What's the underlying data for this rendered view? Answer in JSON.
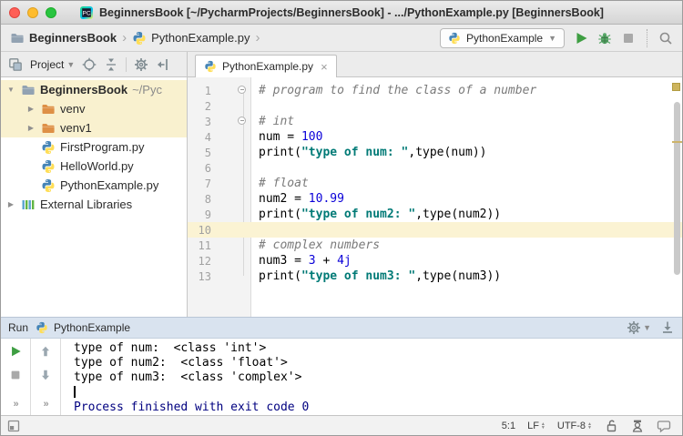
{
  "window": {
    "title": "BeginnersBook [~/PycharmProjects/BeginnersBook] - .../PythonExample.py [BeginnersBook]"
  },
  "toolbar": {
    "breadcrumbs": [
      {
        "label": "BeginnersBook",
        "icon": "folder-gray",
        "bold": true
      },
      {
        "label": "PythonExample.py",
        "icon": "python",
        "bold": false
      }
    ],
    "run_config": "PythonExample"
  },
  "project_panel": {
    "title": "Project",
    "tree": [
      {
        "label": "BeginnersBook",
        "suffix": "~/Pyc",
        "icon": "folder-gray",
        "arrow": "expanded",
        "indent": 0,
        "bold": true,
        "highlight": true
      },
      {
        "label": "venv",
        "icon": "folder-orange",
        "arrow": "collapsed",
        "indent": 1,
        "highlight": true
      },
      {
        "label": "venv1",
        "icon": "folder-orange",
        "arrow": "collapsed",
        "indent": 1,
        "highlight": true
      },
      {
        "label": "FirstProgram.py",
        "icon": "python",
        "indent": 1
      },
      {
        "label": "HelloWorld.py",
        "icon": "python",
        "indent": 1
      },
      {
        "label": "PythonExample.py",
        "icon": "python",
        "indent": 1
      },
      {
        "label": "External Libraries",
        "icon": "external-libraries",
        "arrow": "collapsed",
        "indent": 0
      }
    ]
  },
  "editor": {
    "tab_label": "PythonExample.py",
    "lines": [
      {
        "n": 1,
        "fold": true,
        "segments": [
          {
            "c": "comment",
            "t": "# program to find the class of a number"
          }
        ]
      },
      {
        "n": 2,
        "segments": []
      },
      {
        "n": 3,
        "fold": true,
        "segments": [
          {
            "c": "comment",
            "t": "# int"
          }
        ]
      },
      {
        "n": 4,
        "segments": [
          {
            "c": "plain",
            "t": "num = "
          },
          {
            "c": "number",
            "t": "100"
          }
        ]
      },
      {
        "n": 5,
        "segments": [
          {
            "c": "plain",
            "t": "print("
          },
          {
            "c": "string",
            "t": "\"type of num: \""
          },
          {
            "c": "plain",
            "t": ",type(num))"
          }
        ]
      },
      {
        "n": 6,
        "segments": []
      },
      {
        "n": 7,
        "segments": [
          {
            "c": "comment",
            "t": "# float"
          }
        ]
      },
      {
        "n": 8,
        "segments": [
          {
            "c": "plain",
            "t": "num2 = "
          },
          {
            "c": "number",
            "t": "10.99"
          }
        ]
      },
      {
        "n": 9,
        "segments": [
          {
            "c": "plain",
            "t": "print("
          },
          {
            "c": "string",
            "t": "\"type of num2: \""
          },
          {
            "c": "plain",
            "t": ",type(num2))"
          }
        ]
      },
      {
        "n": 10,
        "highlight": true,
        "segments": []
      },
      {
        "n": 11,
        "segments": [
          {
            "c": "comment",
            "t": "# complex numbers"
          }
        ]
      },
      {
        "n": 12,
        "segments": [
          {
            "c": "plain",
            "t": "num3 = "
          },
          {
            "c": "number",
            "t": "3"
          },
          {
            "c": "plain",
            "t": " + "
          },
          {
            "c": "number",
            "t": "4j"
          }
        ]
      },
      {
        "n": 13,
        "segments": [
          {
            "c": "plain",
            "t": "print("
          },
          {
            "c": "string",
            "t": "\"type of num3: \""
          },
          {
            "c": "plain",
            "t": ",type(num3))"
          }
        ]
      }
    ]
  },
  "run_panel": {
    "title": "Run",
    "tab_label": "PythonExample",
    "output": [
      {
        "c": "stdout",
        "t": "type of num:  <class 'int'>"
      },
      {
        "c": "stdout",
        "t": "type of num2:  <class 'float'>"
      },
      {
        "c": "stdout",
        "t": "type of num3:  <class 'complex'>"
      },
      {
        "c": "caret",
        "t": ""
      },
      {
        "c": "system",
        "t": "Process finished with exit code 0"
      }
    ]
  },
  "status_bar": {
    "caret_position": "5:1",
    "line_separator": "LF",
    "encoding": "UTF-8"
  },
  "icons": {
    "pycharm-app-icon": "PyCharm logo",
    "folder-icon": "folder",
    "python-file-icon": "python two-tone logo",
    "run-icon": "green play triangle",
    "debug-icon": "green bug",
    "stop-icon": "gray square",
    "search-everywhere-icon": "magnifier",
    "settings-gear-icon": "gear",
    "locate-icon": "crosshair circle",
    "collapse-all-icon": "arrows toward center line",
    "hide-panel-icon": "bar with left arrow",
    "hide-run-panel-icon": "arrow down onto bar",
    "external-libraries-icon": "blue and green bars",
    "unlock-icon": "open padlock",
    "inspector-icon": "person with hat (Hector)",
    "event-log-icon": "speech bubble",
    "rerun-icon": "green play triangle",
    "up-arrow-icon": "up arrow",
    "down-arrow-icon": "down arrow",
    "overflow-chevrons-icon": "double chevron",
    "toolwindow-toggle-icon": "square with filled corner",
    "close-tab-icon": "x",
    "breadcrumb-chevron-icon": "angle bracket",
    "fold-region-icon": "circle with minus"
  },
  "colors": {
    "string": "#007a76",
    "number": "#0a00d8",
    "comment": "#7a7a7a",
    "system_output": "#000080",
    "current_line": "#fbf3d3",
    "tree_highlight": "#f9f1cf",
    "run_header_bg": "#d9e3ef",
    "traffic_close": "#ff5f57",
    "traffic_min": "#febc2e",
    "traffic_max": "#29c440",
    "play_green": "#3e9e42",
    "folder_orange": "#de9046",
    "folder_gray": "#92a2b2"
  }
}
